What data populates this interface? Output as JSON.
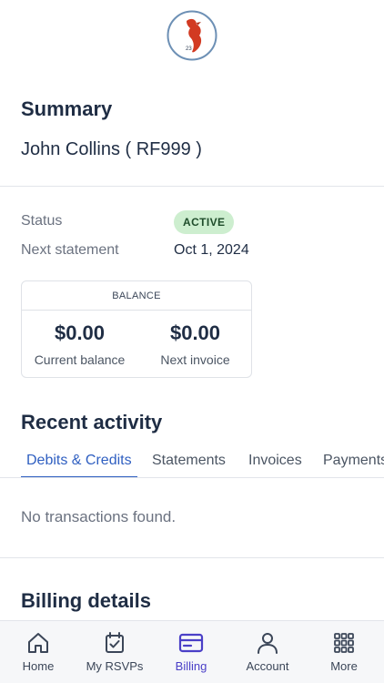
{
  "logo": {
    "number": "23",
    "ring_color": "#6d90b5",
    "bird_color": "#d23a22"
  },
  "summary": {
    "title": "Summary",
    "member": "John Collins ( RF999 )"
  },
  "details": {
    "status_label": "Status",
    "status_value": "ACTIVE",
    "next_statement_label": "Next statement",
    "next_statement_value": "Oct 1, 2024"
  },
  "balance": {
    "header": "BALANCE",
    "current_amount": "$0.00",
    "current_label": "Current balance",
    "next_amount": "$0.00",
    "next_label": "Next invoice"
  },
  "activity": {
    "title": "Recent activity",
    "tabs": [
      "Debits & Credits",
      "Statements",
      "Invoices",
      "Payments"
    ],
    "active_tab": 0,
    "empty_message": "No transactions found."
  },
  "billing": {
    "title": "Billing details"
  },
  "nav": {
    "items": [
      {
        "label": "Home",
        "icon": "home-icon"
      },
      {
        "label": "My RSVPs",
        "icon": "calendar-check-icon"
      },
      {
        "label": "Billing",
        "icon": "credit-card-icon"
      },
      {
        "label": "Account",
        "icon": "person-icon"
      },
      {
        "label": "More",
        "icon": "grid-dots-icon"
      }
    ],
    "active": 2,
    "active_color": "#4a3fc7"
  }
}
